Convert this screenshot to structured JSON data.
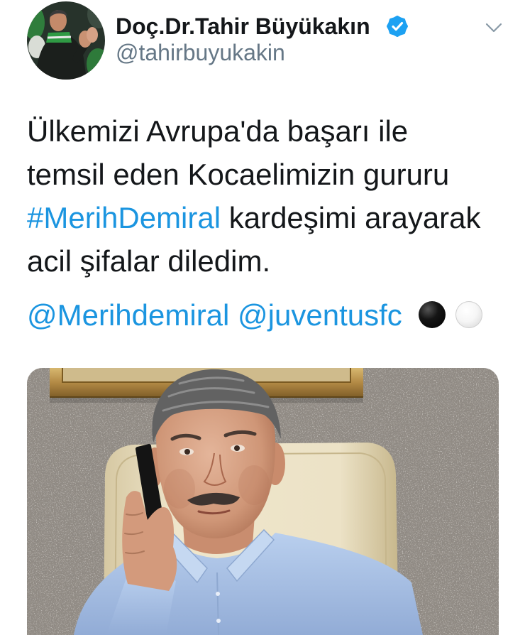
{
  "tweet": {
    "author": {
      "display_name": "Doç.Dr.Tahir Büyükakın",
      "handle": "@tahirbuyukakin",
      "verified": true
    },
    "icons": {
      "avatar": "profile-avatar",
      "verified": "verified-badge-icon",
      "menu": "chevron-down-icon"
    },
    "text": {
      "line1": "Ülkemizi Avrupa'da başarı ile",
      "line2": "temsil eden Kocaelimizin gururu",
      "hashtag": "#MerihDemiral",
      "line3_rest": " kardeşimi arayarak",
      "line4": "acil şifalar diledim."
    },
    "mentions": [
      "@Merihdemiral",
      "@juventusfc"
    ],
    "emojis": [
      "black-circle-emoji",
      "white-circle-emoji"
    ]
  },
  "colors": {
    "text": "#14171a",
    "secondary": "#657786",
    "link": "#1b95e0",
    "verified": "#1da1f2",
    "background": "#ffffff"
  }
}
